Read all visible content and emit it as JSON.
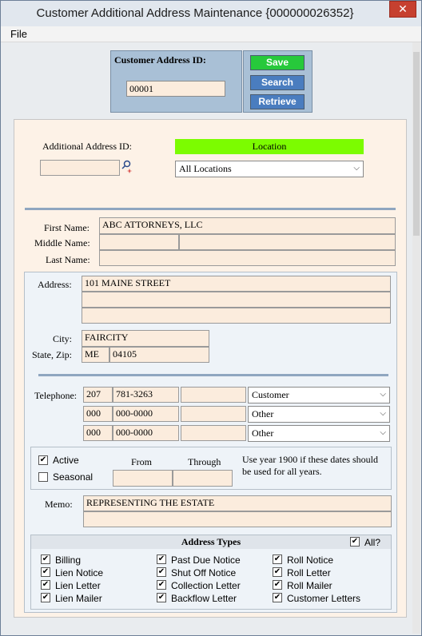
{
  "window": {
    "title": "Customer Additional Address Maintenance {000000026352}",
    "close": "✕"
  },
  "menu": {
    "file": "File"
  },
  "header": {
    "customer_address_id_label": "Customer Address ID:",
    "customer_address_id_value": "00001"
  },
  "buttons": {
    "save": "Save",
    "search": "Search",
    "retrieve": "Retrieve"
  },
  "additional": {
    "label": "Additional Address ID:",
    "value": "",
    "location_label": "Location",
    "location_value": "All Locations"
  },
  "name": {
    "first_label": "First Name:",
    "first_value": "ABC ATTORNEYS, LLC",
    "middle_label": "Middle Name:",
    "middle_value": "",
    "last_label": "Last Name:",
    "last_value": ""
  },
  "address": {
    "label": "Address:",
    "line1": "101 MAINE STREET",
    "line2": "",
    "line3": "",
    "city_label": "City:",
    "city": "FAIRCITY",
    "statezip_label": "State, Zip:",
    "state": "ME",
    "zip": "04105"
  },
  "telephone": {
    "label": "Telephone:",
    "rows": [
      {
        "area": "207",
        "number": "781-3263",
        "ext": "",
        "type": "Customer"
      },
      {
        "area": "000",
        "number": "000-0000",
        "ext": "",
        "type": "Other"
      },
      {
        "area": "000",
        "number": "000-0000",
        "ext": "",
        "type": "Other"
      }
    ]
  },
  "status": {
    "active_label": "Active",
    "active": true,
    "seasonal_label": "Seasonal",
    "seasonal": false,
    "from_label": "From",
    "through_label": "Through",
    "from_value": "",
    "through_value": "",
    "note": "Use year 1900 if these dates should be used for all years."
  },
  "memo": {
    "label": "Memo:",
    "line1": "REPRESENTING THE ESTATE",
    "line2": ""
  },
  "address_types": {
    "title": "Address Types",
    "all_label": "All?",
    "col1": [
      "Billing",
      "Lien Notice",
      "Lien Letter",
      "Lien Mailer"
    ],
    "col2": [
      "Past Due Notice",
      "Shut Off Notice",
      "Collection Letter",
      "Backflow Letter"
    ],
    "col3": [
      "Roll Notice",
      "Roll Letter",
      "Roll Mailer",
      "Customer Letters"
    ]
  },
  "colors": {
    "accent_green": "#7cfc00",
    "button_blue": "#4a7dbf",
    "save_green": "#27c93b",
    "field_bg": "#fbecdd",
    "header_bg": "#a9c0d6"
  }
}
